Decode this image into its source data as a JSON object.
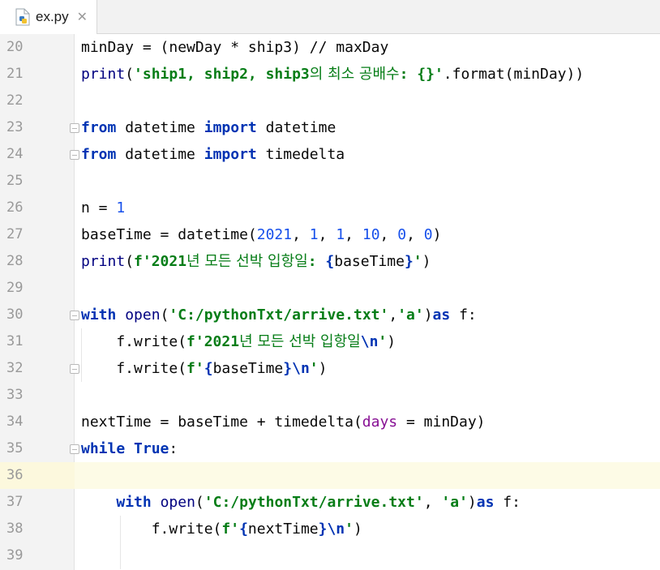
{
  "tab": {
    "label": "ex.py",
    "close_icon": "close-icon",
    "file_icon": "python-file-icon"
  },
  "lines": [
    {
      "num": "20",
      "text": "minDay = (newDay * ship3) // maxDay"
    },
    {
      "num": "21",
      "text": "print('ship1, ship2, ship3의 최소 공배수: {}'.format(minDay))"
    },
    {
      "num": "22",
      "text": ""
    },
    {
      "num": "23",
      "text": "from datetime import datetime"
    },
    {
      "num": "24",
      "text": "from datetime import timedelta"
    },
    {
      "num": "25",
      "text": ""
    },
    {
      "num": "26",
      "text": "n = 1"
    },
    {
      "num": "27",
      "text": "baseTime = datetime(2021, 1, 1, 10, 0, 0)"
    },
    {
      "num": "28",
      "text": "print(f'2021년 모든 선박 입항일: {baseTime}')"
    },
    {
      "num": "29",
      "text": ""
    },
    {
      "num": "30",
      "text": "with open('C:/pythonTxt/arrive.txt','a')as f:"
    },
    {
      "num": "31",
      "text": "    f.write(f'2021년 모든 선박 입항일\\n')"
    },
    {
      "num": "32",
      "text": "    f.write(f'{baseTime}\\n')"
    },
    {
      "num": "33",
      "text": ""
    },
    {
      "num": "34",
      "text": "nextTime = baseTime + timedelta(days = minDay)"
    },
    {
      "num": "35",
      "text": "while True:"
    },
    {
      "num": "36",
      "text": ""
    },
    {
      "num": "37",
      "text": "    with open('C:/pythonTxt/arrive.txt', 'a')as f:"
    },
    {
      "num": "38",
      "text": "        f.write(f'{nextTime}\\n')"
    },
    {
      "num": "39",
      "text": ""
    }
  ],
  "current_line": "36",
  "colors": {
    "keyword": "#0033b3",
    "string": "#067d17",
    "number": "#1750eb",
    "param": "#871094",
    "current_line_bg": "#fdfbe6"
  }
}
